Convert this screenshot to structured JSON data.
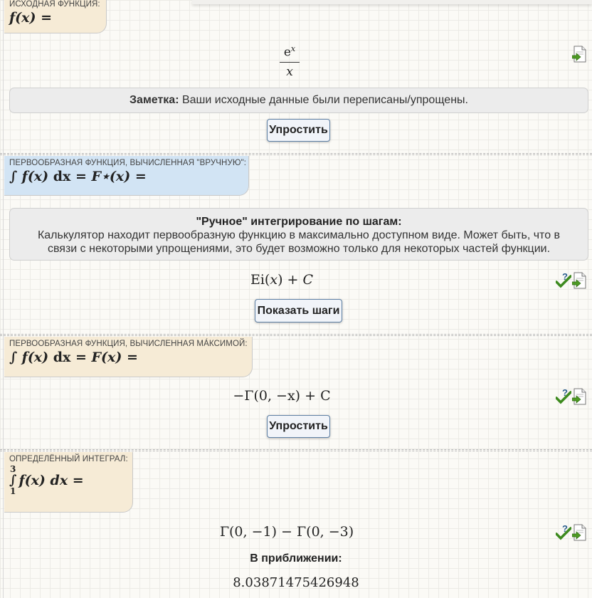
{
  "source_function": {
    "label": "ИСХОДНАЯ ФУНКЦИЯ:",
    "formula": "f(x) =",
    "numerator": "e",
    "exponent": "x",
    "denominator": "x",
    "note_bold": "Заметка:",
    "note_text": " Ваши исходные данные были переписаны/упрощены.",
    "button": "Упростить"
  },
  "manual_antiderivative": {
    "label": "ПЕРВООБРАЗНАЯ ФУНКЦИЯ, ВЫЧИСЛЕННАЯ \"ВРУЧНУЮ\":",
    "formula_fx": "f(x)",
    "formula_dx": "dx",
    "formula_rest": "= F⋆(x) =",
    "info_title": "\"Ручное\" интегрирование по шагам:",
    "info_text": "Калькулятор находит первообразную функцию в максимально доступном виде. Может быть, что в связи с некоторыми упрощениями, это будет возможно только для некоторых частей функции.",
    "result_ei": "Ei",
    "result_x": "x",
    "result_c": "C",
    "button": "Показать шаги"
  },
  "maxima_antiderivative": {
    "label": "ПЕРВООБРАЗНАЯ ФУНКЦИЯ, ВЫЧИСЛЕННАЯ MÁКСИМОЙ:",
    "formula_fx": "f(x)",
    "formula_dx": "dx",
    "formula_rest": "= F(x) =",
    "result": "−Γ(0, −x) + C",
    "button": "Упростить"
  },
  "definite_integral": {
    "label": "ОПРЕДЕЛЁННЫЙ ИНТЕГРАЛ:",
    "upper": "3",
    "lower": "1",
    "formula": "f(x) dx =",
    "result": "Γ(0, −1) − Γ(0, −3)",
    "approx_label": "В приближении:",
    "approx_value": "8.03871475426948"
  },
  "icons": {
    "check": "check-question-icon",
    "doc": "document-export-icon"
  },
  "colors": {
    "beige_tag": "#f6ebd6",
    "blue_tag": "#d2e4f4",
    "button_border": "#5d7fa3",
    "check_green": "#3d8a1e"
  }
}
